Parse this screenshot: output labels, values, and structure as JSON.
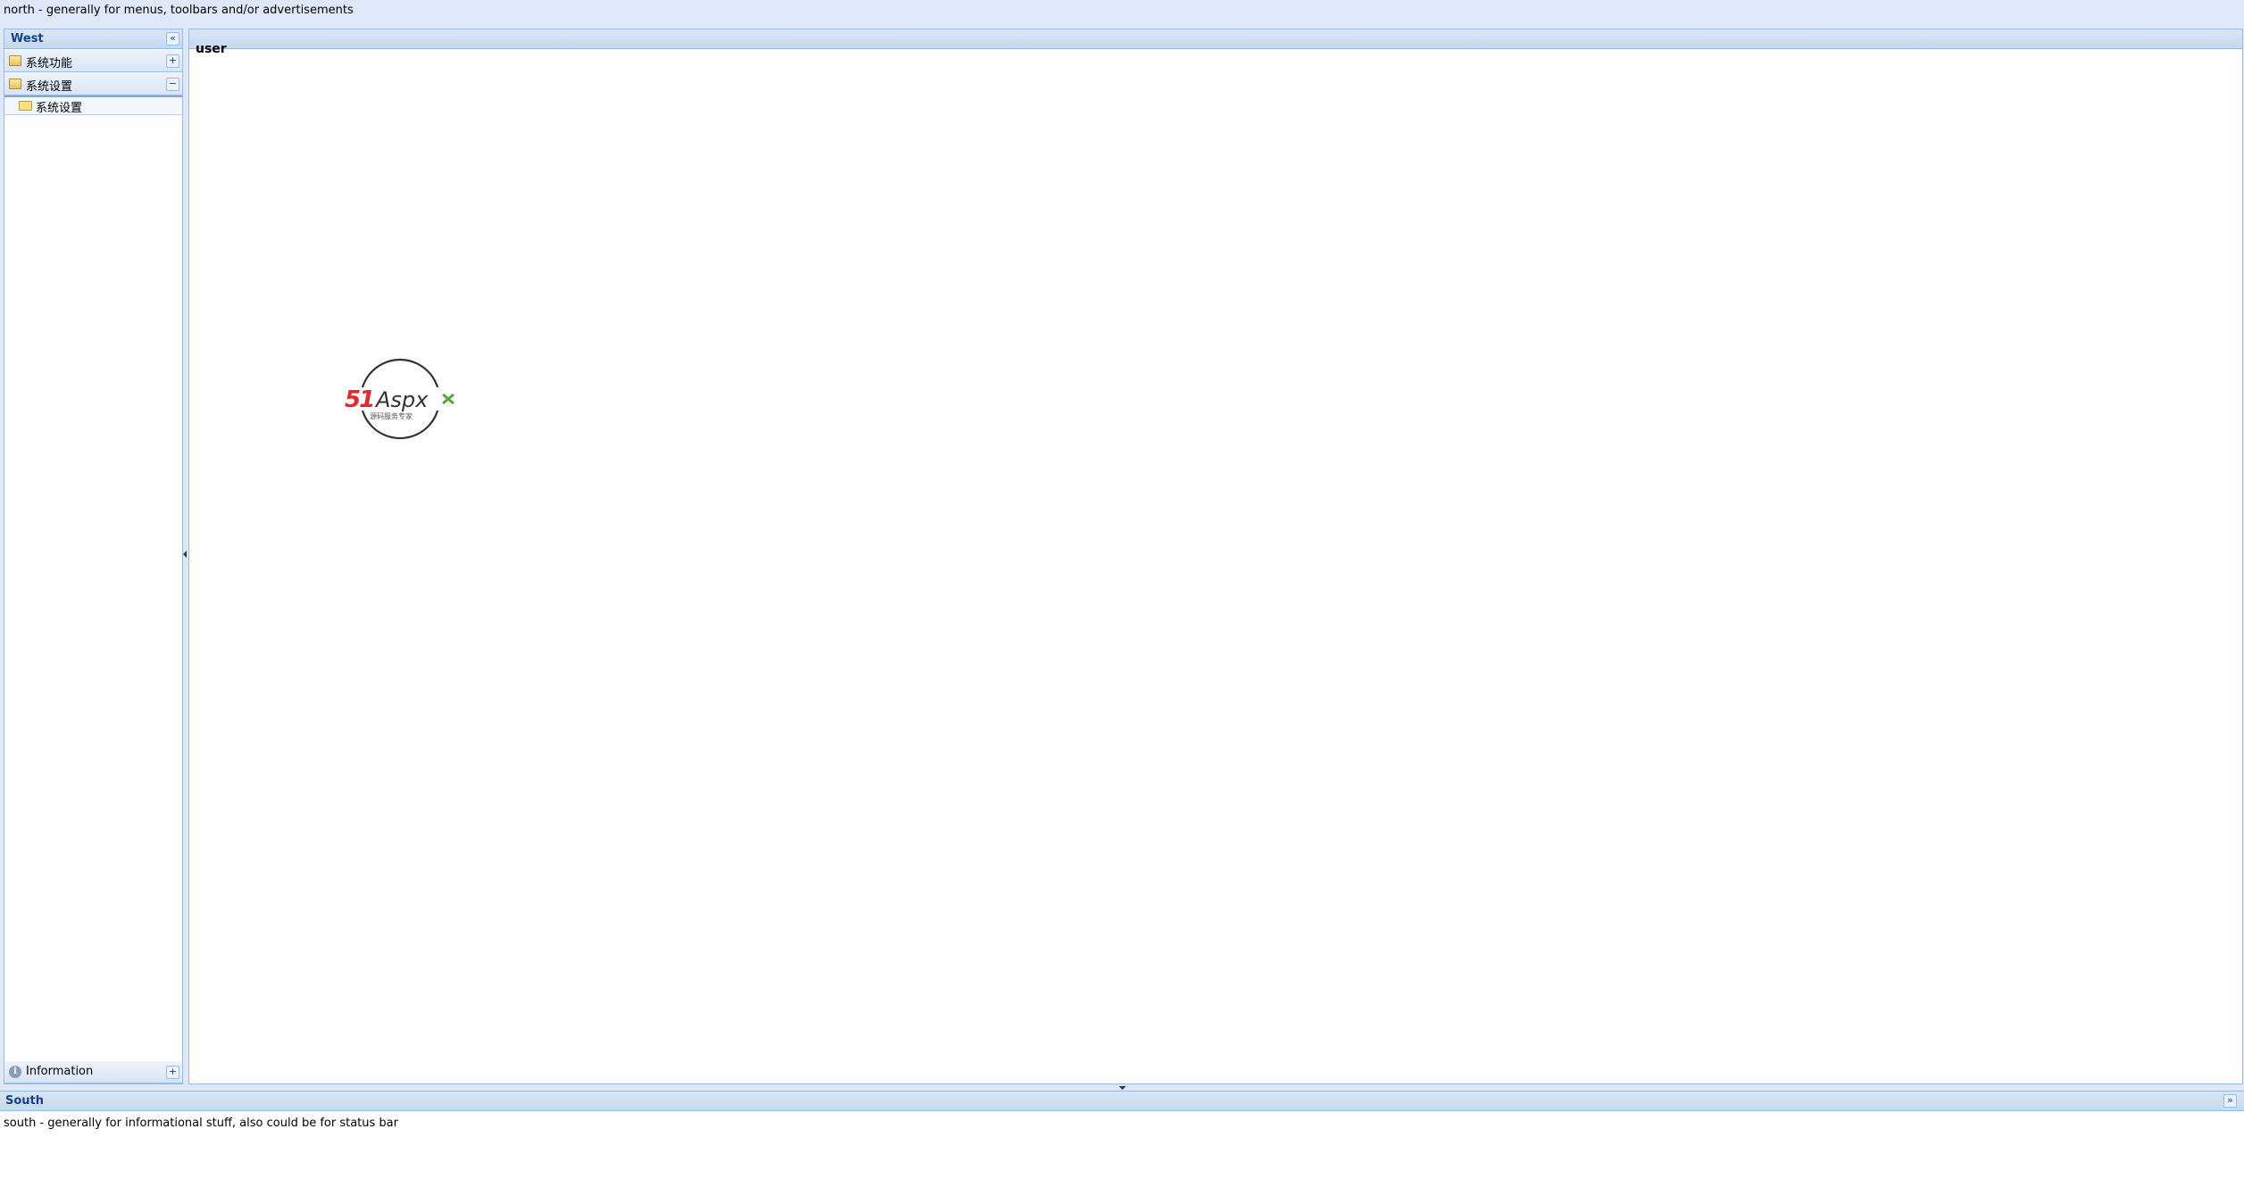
{
  "north": {
    "text": "north - generally for menus, toolbars and/or advertisements"
  },
  "west": {
    "title": "West",
    "collapse_icon": "double-chevron-left-icon",
    "sections": [
      {
        "label": "系统功能",
        "icon": "folder-gear-icon",
        "toggle": "+"
      },
      {
        "label": "系统设置",
        "icon": "folder-open-icon",
        "toggle": "−"
      }
    ],
    "tree_items": [
      {
        "label": "系统设置",
        "icon": "folder-icon"
      }
    ],
    "info_section": {
      "label": "Information",
      "icon": "info-icon",
      "toggle": "+"
    }
  },
  "center": {
    "title": "user"
  },
  "logo": {
    "brand_red": "51",
    "brand_rest": "Aspx",
    "tagline": "源码服务专家",
    "colors": {
      "red": "#e8262d",
      "green": "#5aa53c",
      "dark": "#333333"
    }
  },
  "south": {
    "title": "South",
    "text": "south - generally for informational stuff, also could be for status bar"
  },
  "colors": {
    "accent": "#15428b",
    "border": "#99bbe8",
    "background": "#dfe8f6"
  }
}
